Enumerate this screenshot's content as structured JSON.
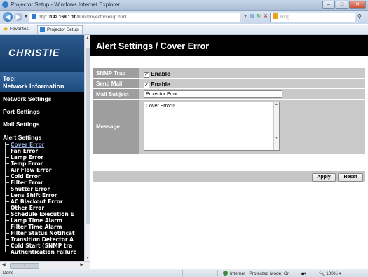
{
  "window": {
    "title": "Projector Setup - Windows Internet Explorer",
    "min": "–",
    "max": "□",
    "close": "✕"
  },
  "browser": {
    "address_prefix": "http://",
    "address_host": "192.168.1.10",
    "address_path": "/html/projectorsetup.html",
    "search_placeholder": "Bing",
    "favorites_label": "Favorites",
    "tab_title": "Projector Setup"
  },
  "sidebar": {
    "logo": "CHRISTIE",
    "top_line1": "Top:",
    "top_line2": "Network Information",
    "network_settings": "Network Settings",
    "port_settings": "Port Settings",
    "mail_settings": "Mail Settings",
    "alert_settings": "Alert Settings",
    "alert_items": [
      "Cover Error",
      "Fan Error",
      "Lamp Error",
      "Temp Error",
      "Air Flow Error",
      "Cold Error",
      "Filter Error",
      "Shutter Error",
      "Lens Shift Error",
      "AC Blackout Error",
      "Other Error",
      "Schedule Execution E",
      "Lamp Time Alarm",
      "Filter Time Alarm",
      "Filter Status Notificat",
      "Transition Detector A",
      "Cold Start (SNMP tra",
      "Authentication Failure"
    ]
  },
  "main": {
    "title": "Alert Settings / Cover Error",
    "snmp_trap_label": "SNMP Trap",
    "snmp_trap_option": "Enable",
    "send_mail_label": "Send Mail",
    "send_mail_option": "Enable",
    "mail_subject_label": "Mail Subject",
    "mail_subject_value": "Projector Error",
    "message_label": "Message",
    "message_value": "Cover Error!!!",
    "apply": "Apply",
    "reset": "Reset"
  },
  "status": {
    "left": "Done",
    "zone": "Internet | Protected Mode: On",
    "zoom": "100%"
  }
}
